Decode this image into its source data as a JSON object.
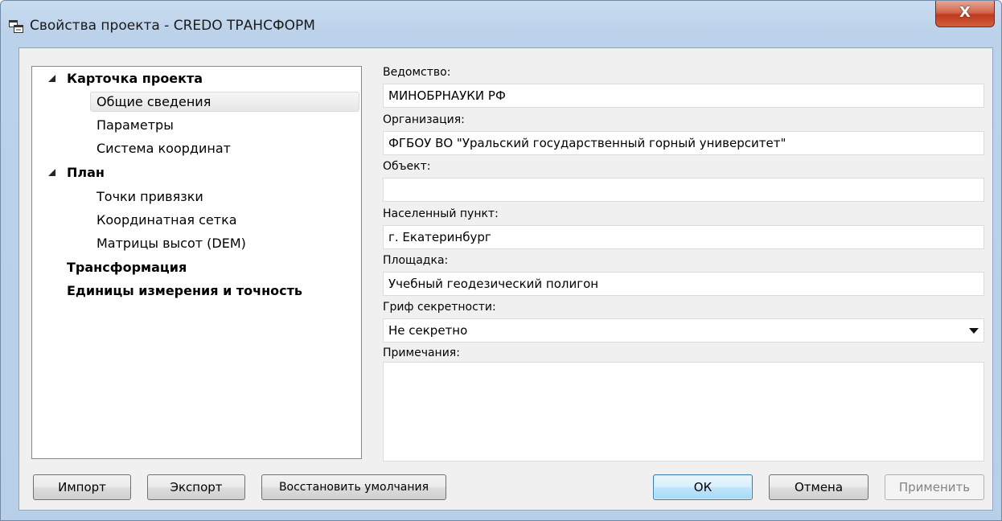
{
  "window": {
    "title": "Свойства проекта - CREDO ТРАНСФОРМ",
    "close_label": "X"
  },
  "tree": {
    "items": [
      {
        "label": "Карточка проекта",
        "level": 0,
        "bold": true,
        "expanded": true
      },
      {
        "label": "Общие сведения",
        "level": 1,
        "bold": false,
        "selected": true
      },
      {
        "label": "Параметры",
        "level": 1,
        "bold": false
      },
      {
        "label": "Система координат",
        "level": 1,
        "bold": false
      },
      {
        "label": "План",
        "level": 0,
        "bold": true,
        "expanded": true
      },
      {
        "label": "Точки привязки",
        "level": 1,
        "bold": false
      },
      {
        "label": "Координатная сетка",
        "level": 1,
        "bold": false
      },
      {
        "label": "Матрицы высот (DEM)",
        "level": 1,
        "bold": false
      },
      {
        "label": "Трансформация",
        "level": 0,
        "bold": true
      },
      {
        "label": "Единицы измерения и точность",
        "level": 0,
        "bold": true
      }
    ]
  },
  "form": {
    "department": {
      "label": "Ведомство:",
      "value": "МИНОБРНАУКИ РФ"
    },
    "organization": {
      "label": "Организация:",
      "value": "ФГБОУ ВО \"Уральский государственный горный университет\""
    },
    "object": {
      "label": "Объект:",
      "value": ""
    },
    "locality": {
      "label": "Населенный пункт:",
      "value": "г. Екатеринбург"
    },
    "site": {
      "label": "Площадка:",
      "value": "Учебный геодезический полигон"
    },
    "secrecy": {
      "label": "Гриф секретности:",
      "value": "Не секретно"
    },
    "notes": {
      "label": "Примечания:",
      "value": ""
    }
  },
  "buttons": {
    "import": "Импорт",
    "export": "Экспорт",
    "restore_defaults": "Восстановить умолчания",
    "ok": "ОК",
    "cancel": "Отмена",
    "apply": "Применить"
  }
}
